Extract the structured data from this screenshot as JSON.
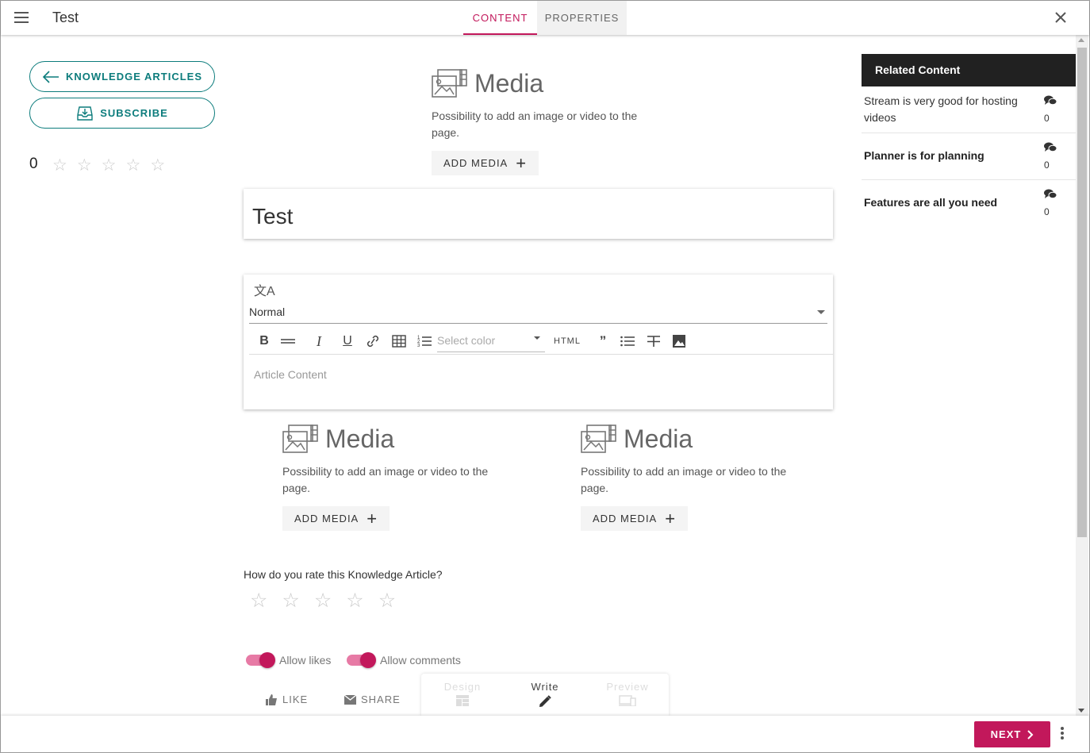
{
  "header": {
    "title": "Test",
    "tabs": [
      {
        "label": "CONTENT",
        "active": true
      },
      {
        "label": "PROPERTIES",
        "active": false
      }
    ]
  },
  "sidebar": {
    "knowledge_articles_label": "KNOWLEDGE ARTICLES",
    "subscribe_label": "SUBSCRIBE",
    "rating_count": "0",
    "stars": 5
  },
  "media": {
    "title": "Media",
    "description": "Possibility to add an image or video to the page.",
    "add_label": "ADD MEDIA"
  },
  "article": {
    "title_value": "Test",
    "format_value": "Normal",
    "color_placeholder": "Select color",
    "html_label": "HTML",
    "content_placeholder": "Article Content"
  },
  "rating": {
    "question": "How do you rate this Knowledge Article?",
    "stars": 5
  },
  "toggles": {
    "allow_likes": "Allow likes",
    "allow_comments": "Allow comments"
  },
  "actions": {
    "like": "LIKE",
    "share": "SHARE"
  },
  "modes": {
    "design": "Design",
    "write": "Write",
    "preview": "Preview",
    "active": "Write"
  },
  "related": {
    "heading": "Related Content",
    "items": [
      {
        "title": "Stream is very good for hosting videos",
        "comments": "0"
      },
      {
        "title": "Planner is for planning",
        "comments": "0"
      },
      {
        "title": "Features are all you need",
        "comments": "0"
      }
    ]
  },
  "footer": {
    "next_label": "NEXT"
  },
  "colors": {
    "accent": "#c2185b",
    "teal": "#0c7c7c",
    "related_header_bg": "#212121"
  }
}
